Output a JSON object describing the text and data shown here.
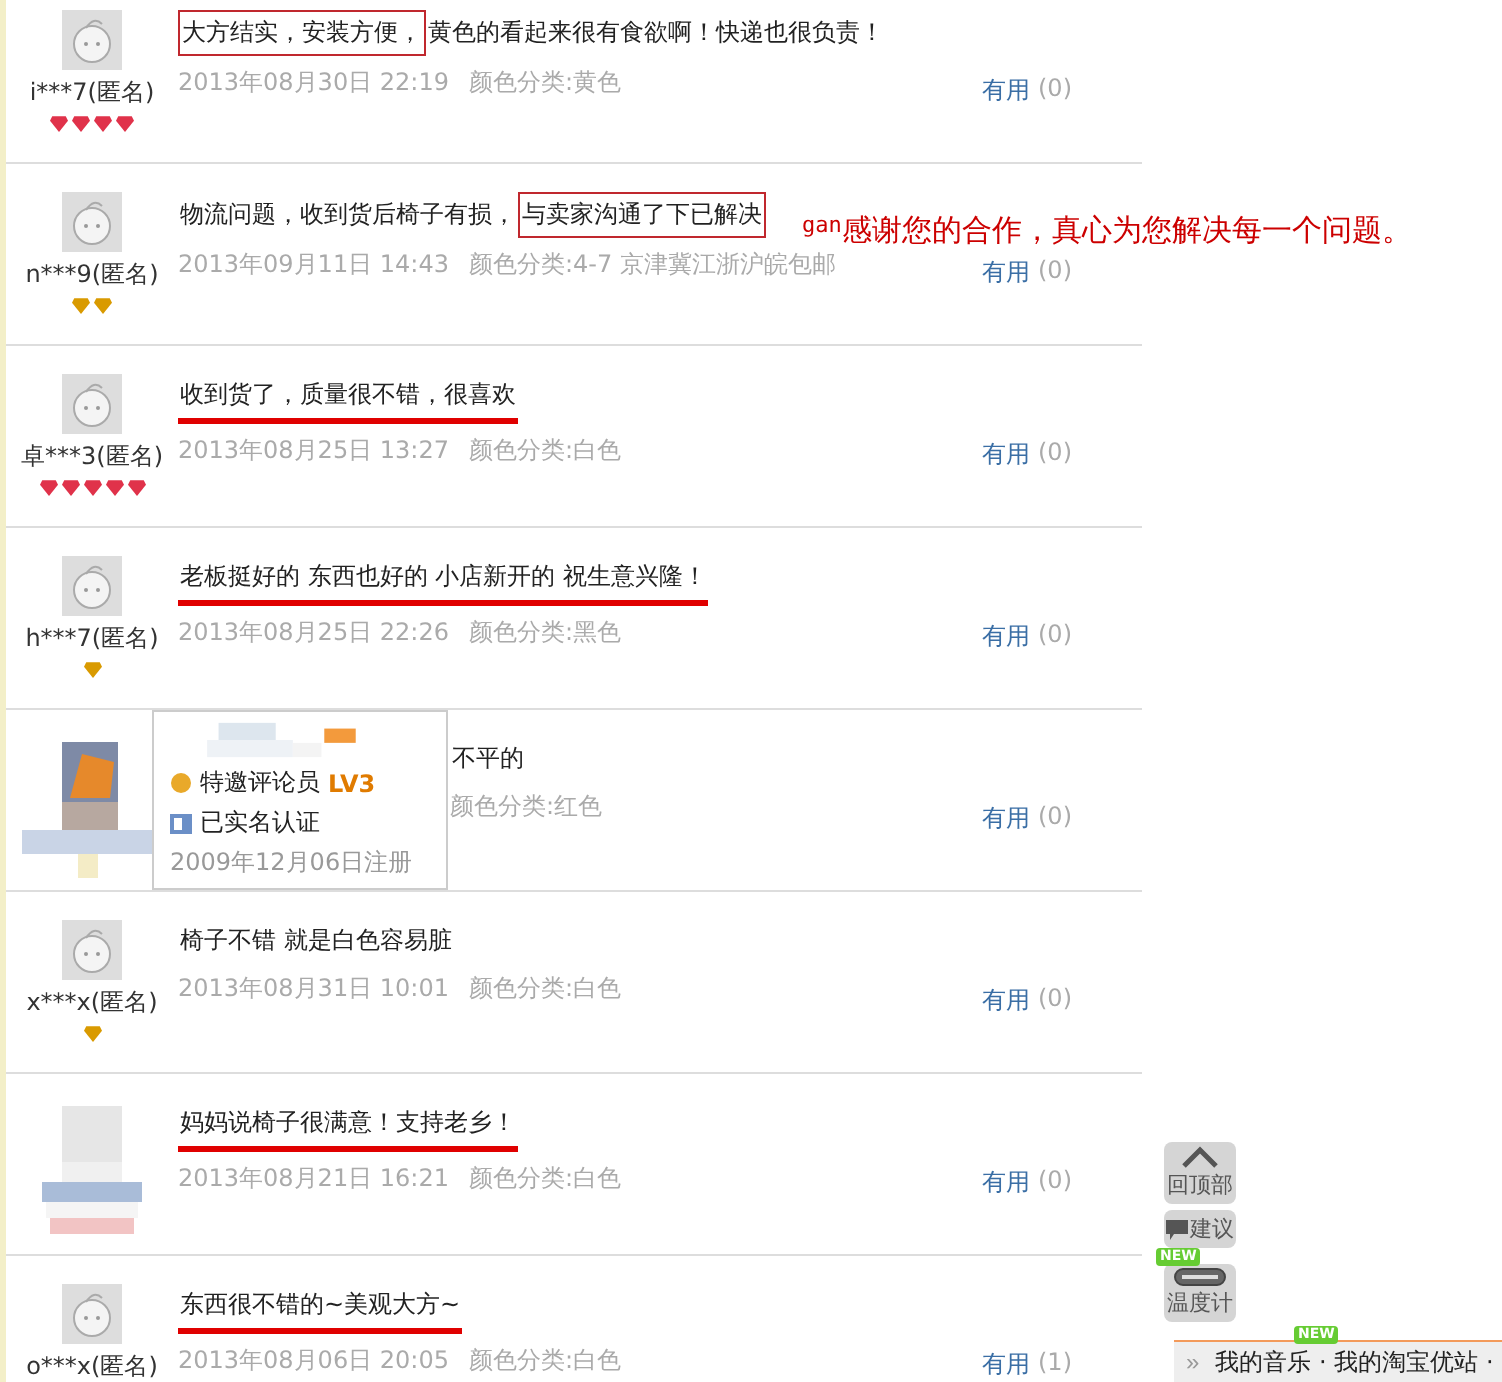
{
  "reviews": [
    {
      "user": "i***7(匿名)",
      "avatar": {
        "kind": "default"
      },
      "credit": [
        {
          "kind": "red"
        },
        {
          "kind": "red"
        },
        {
          "kind": "red"
        },
        {
          "kind": "red"
        }
      ],
      "segments": [
        {
          "text": "大方结实，安装方便，",
          "kind": "box"
        },
        {
          "text": "黄色的看起来很有食欲啊！快递也很负责！",
          "kind": "plain"
        }
      ],
      "date": "2013年08月30日 22:19",
      "variant": "颜色分类:黄色",
      "useful_label": "有用",
      "useful_count": "(0)"
    },
    {
      "user": "n***9(匿名)",
      "avatar": {
        "kind": "default"
      },
      "credit": [
        {
          "kind": "gold"
        },
        {
          "kind": "gold"
        }
      ],
      "segments": [
        {
          "text": "物流问题，收到货后椅子有损，",
          "kind": "plain"
        },
        {
          "text": "与卖家沟通了下已解决",
          "kind": "box"
        }
      ],
      "date": "2013年09月11日 14:43",
      "variant": "颜色分类:4-7 京津冀江浙沪皖包邮",
      "useful_label": "有用",
      "useful_count": "(0)"
    },
    {
      "user": "卓***3(匿名)",
      "avatar": {
        "kind": "default"
      },
      "credit": [
        {
          "kind": "red"
        },
        {
          "kind": "red"
        },
        {
          "kind": "red"
        },
        {
          "kind": "red"
        },
        {
          "kind": "red"
        }
      ],
      "segments": [
        {
          "text": "收到货了，质量很不错，很喜欢",
          "kind": "underline"
        }
      ],
      "date": "2013年08月25日 13:27",
      "variant": "颜色分类:白色",
      "useful_label": "有用",
      "useful_count": "(0)"
    },
    {
      "user": "h***7(匿名)",
      "avatar": {
        "kind": "default"
      },
      "credit": [
        {
          "kind": "gold"
        }
      ],
      "segments": [
        {
          "text": "老板挺好的 东西也好的 小店新开的 祝生意兴隆！",
          "kind": "underline"
        }
      ],
      "date": "2013年08月25日 22:26",
      "variant": "颜色分类:黑色",
      "useful_label": "有用",
      "useful_count": "(0)"
    },
    {
      "avatar": {
        "kind": "picture"
      },
      "covered": true,
      "segments": [
        {
          "text": "不平的",
          "kind": "plain"
        }
      ],
      "variant": "颜色分类:红色",
      "useful_label": "有用",
      "useful_count": "(0)"
    },
    {
      "user": "x***x(匿名)",
      "avatar": {
        "kind": "default"
      },
      "credit": [
        {
          "kind": "gold"
        }
      ],
      "segments": [
        {
          "text": "椅子不错 就是白色容易脏",
          "kind": "plain"
        }
      ],
      "date": "2013年08月31日 10:01",
      "variant": "颜色分类:白色",
      "useful_label": "有用",
      "useful_count": "(0)"
    },
    {
      "avatar": {
        "kind": "picture"
      },
      "segments": [
        {
          "text": "妈妈说椅子很满意！支持老乡！",
          "kind": "underline"
        }
      ],
      "date": "2013年08月21日 16:21",
      "variant": "颜色分类:白色",
      "useful_label": "有用",
      "useful_count": "(0)"
    },
    {
      "user": "o***x(匿名)",
      "avatar": {
        "kind": "default"
      },
      "segments": [
        {
          "text": "东西很不错的~美观大方~",
          "kind": "underline"
        }
      ],
      "date": "2013年08月06日 20:05",
      "variant": "颜色分类:白色",
      "useful_label": "有用",
      "useful_count": "(1)"
    }
  ],
  "user_card": {
    "title": "特邀评论员",
    "level": "LV3",
    "verified": "已实名认证",
    "registered": "2009年12月06日注册"
  },
  "annotation": {
    "prefix": "gan",
    "text": "感谢您的合作，真心为您解决每一个问题。"
  },
  "side_tools": [
    {
      "kind": "top",
      "label": "回顶部"
    },
    {
      "kind": "feedback",
      "label": "建议"
    },
    {
      "kind": "thermometer",
      "label": "温度计",
      "badge": "NEW"
    }
  ],
  "bottom_bar": {
    "toggle": "»",
    "badge": "NEW",
    "text": "我的音乐 · 我的淘宝优站 ·"
  }
}
